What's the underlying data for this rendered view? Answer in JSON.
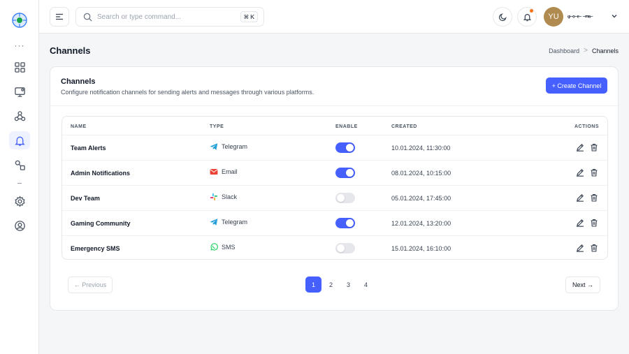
{
  "header": {
    "search_placeholder": "Search or type command...",
    "search_shortcut": "⌘ K",
    "avatar_initials": "YU",
    "user_name": "ᵩ₋ₒ₋ₑ₋ ₋ₘₐ₋"
  },
  "sidebar": {
    "dots": "···",
    "items": [
      {
        "icon": "dashboard-grid-icon"
      },
      {
        "icon": "monitor-icon"
      },
      {
        "icon": "webhook-icon"
      },
      {
        "icon": "bell-icon",
        "active": true
      },
      {
        "icon": "integrations-icon"
      },
      {
        "icon": "settings-gear-icon"
      },
      {
        "icon": "user-circle-icon"
      }
    ]
  },
  "page": {
    "title": "Channels",
    "breadcrumb": {
      "home": "Dashboard",
      "separator": ">",
      "current": "Channels"
    }
  },
  "card": {
    "title": "Channels",
    "description": "Configure notification channels for sending alerts and messages through various platforms.",
    "create_button": "+ Create Channel"
  },
  "table": {
    "columns": {
      "name": "NAME",
      "type": "TYPE",
      "enable": "ENABLE",
      "created": "CREATED",
      "actions": "ACTIONS"
    },
    "rows": [
      {
        "name": "Team Alerts",
        "type": "Telegram",
        "enabled": true,
        "created": "10.01.2024, 11:30:00"
      },
      {
        "name": "Admin Notifications",
        "type": "Email",
        "enabled": true,
        "created": "08.01.2024, 10:15:00"
      },
      {
        "name": "Dev Team",
        "type": "Slack",
        "enabled": false,
        "created": "05.01.2024, 17:45:00"
      },
      {
        "name": "Gaming Community",
        "type": "Telegram",
        "enabled": true,
        "created": "12.01.2024, 13:20:00"
      },
      {
        "name": "Emergency SMS",
        "type": "SMS",
        "enabled": false,
        "created": "15.01.2024, 16:10:00"
      }
    ]
  },
  "pagination": {
    "previous": "← Previous",
    "next": "Next →",
    "pages": [
      "1",
      "2",
      "3",
      "4"
    ],
    "current": "1"
  },
  "colors": {
    "accent": "#465fff",
    "telegram": "#229ed9",
    "email": "#ea4335",
    "sms": "#25d366",
    "notification_dot": "#f97316"
  }
}
